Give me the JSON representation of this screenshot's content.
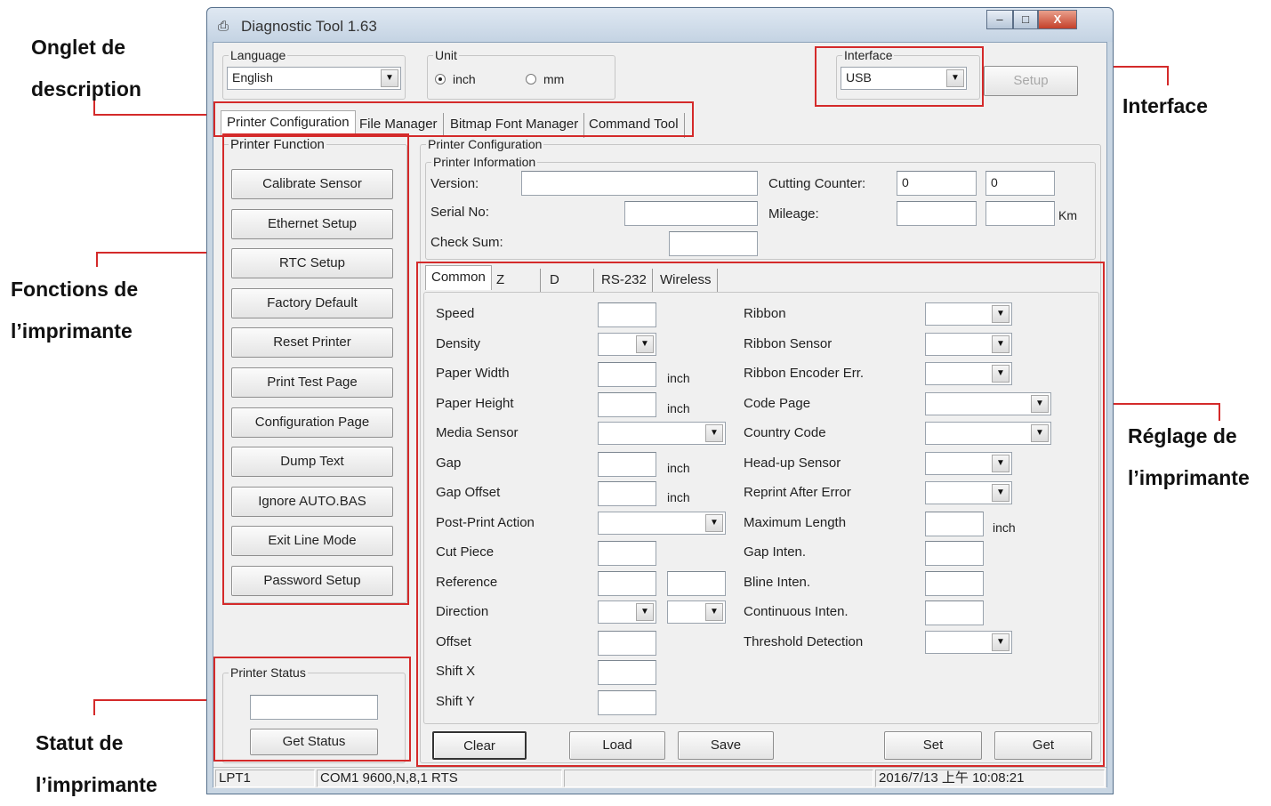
{
  "annotations": {
    "tab_desc": [
      "Onglet de",
      "description"
    ],
    "interface": "Interface",
    "functions": [
      "Fonctions de",
      "l’imprimante"
    ],
    "settings": [
      "Réglage de",
      "l’imprimante"
    ],
    "status": [
      "Statut de",
      "l’imprimante"
    ],
    "accent_color": "#d42a2a"
  },
  "window": {
    "title": "Diagnostic Tool 1.63",
    "controls": {
      "minimize": "–",
      "maximize": "□",
      "close": "X"
    }
  },
  "top": {
    "language_label": "Language",
    "language_value": "English",
    "unit_label": "Unit",
    "unit_inch": "inch",
    "unit_mm": "mm",
    "unit_selected": "inch",
    "interface_label": "Interface",
    "interface_value": "USB",
    "setup_button": "Setup"
  },
  "tabs": [
    "Printer Configuration",
    "File Manager",
    "Bitmap Font Manager",
    "Command Tool"
  ],
  "printer_function": {
    "title": "Printer Function",
    "buttons": [
      "Calibrate Sensor",
      "Ethernet Setup",
      "RTC Setup",
      "Factory Default",
      "Reset Printer",
      "Print Test Page",
      "Configuration Page",
      "Dump Text",
      "Ignore AUTO.BAS",
      "Exit Line Mode",
      "Password Setup"
    ]
  },
  "printer_status": {
    "title": "Printer Status",
    "value": "",
    "get_status": "Get Status"
  },
  "config": {
    "title": "Printer Configuration",
    "info_title": "Printer Information",
    "version_label": "Version:",
    "version_value": "",
    "serial_label": "Serial No:",
    "serial_value": "",
    "checksum_label": "Check Sum:",
    "checksum_value": "",
    "cutting_label": "Cutting Counter:",
    "cutting_value1": "0",
    "cutting_value2": "0",
    "mileage_label": "Mileage:",
    "mileage_unit": "Km",
    "sub_tabs": [
      "Common",
      "Z",
      "D",
      "RS-232",
      "Wireless"
    ],
    "left_fields": [
      {
        "label": "Speed",
        "kind": "input"
      },
      {
        "label": "Density",
        "kind": "select"
      },
      {
        "label": "Paper Width",
        "kind": "input",
        "unit": "inch"
      },
      {
        "label": "Paper Height",
        "kind": "input",
        "unit": "inch"
      },
      {
        "label": "Media Sensor",
        "kind": "wide-select"
      },
      {
        "label": "Gap",
        "kind": "input",
        "unit": "inch"
      },
      {
        "label": "Gap Offset",
        "kind": "input",
        "unit": "inch"
      },
      {
        "label": "Post-Print Action",
        "kind": "wide-select"
      },
      {
        "label": "Cut Piece",
        "kind": "input"
      },
      {
        "label": "Reference",
        "kind": "two-input"
      },
      {
        "label": "Direction",
        "kind": "two-select"
      },
      {
        "label": "Offset",
        "kind": "input"
      },
      {
        "label": "Shift X",
        "kind": "input"
      },
      {
        "label": "Shift Y",
        "kind": "input"
      }
    ],
    "right_fields": [
      {
        "label": "Ribbon",
        "kind": "select"
      },
      {
        "label": "Ribbon Sensor",
        "kind": "select"
      },
      {
        "label": "Ribbon Encoder Err.",
        "kind": "select"
      },
      {
        "label": "Code Page",
        "kind": "wide-select"
      },
      {
        "label": "Country Code",
        "kind": "wide-select"
      },
      {
        "label": "Head-up Sensor",
        "kind": "select"
      },
      {
        "label": "Reprint After Error",
        "kind": "select"
      },
      {
        "label": "Maximum Length",
        "kind": "input",
        "unit": "inch"
      },
      {
        "label": "Gap Inten.",
        "kind": "input"
      },
      {
        "label": "Bline Inten.",
        "kind": "input"
      },
      {
        "label": "Continuous Inten.",
        "kind": "input"
      },
      {
        "label": "Threshold Detection",
        "kind": "select"
      }
    ],
    "buttons": [
      "Clear",
      "Load",
      "Save",
      "Set",
      "Get"
    ]
  },
  "statusbar": {
    "port": "LPT1",
    "com": "COM1 9600,N,8,1 RTS",
    "middle": "",
    "datetime": "2016/7/13 上午 10:08:21"
  }
}
